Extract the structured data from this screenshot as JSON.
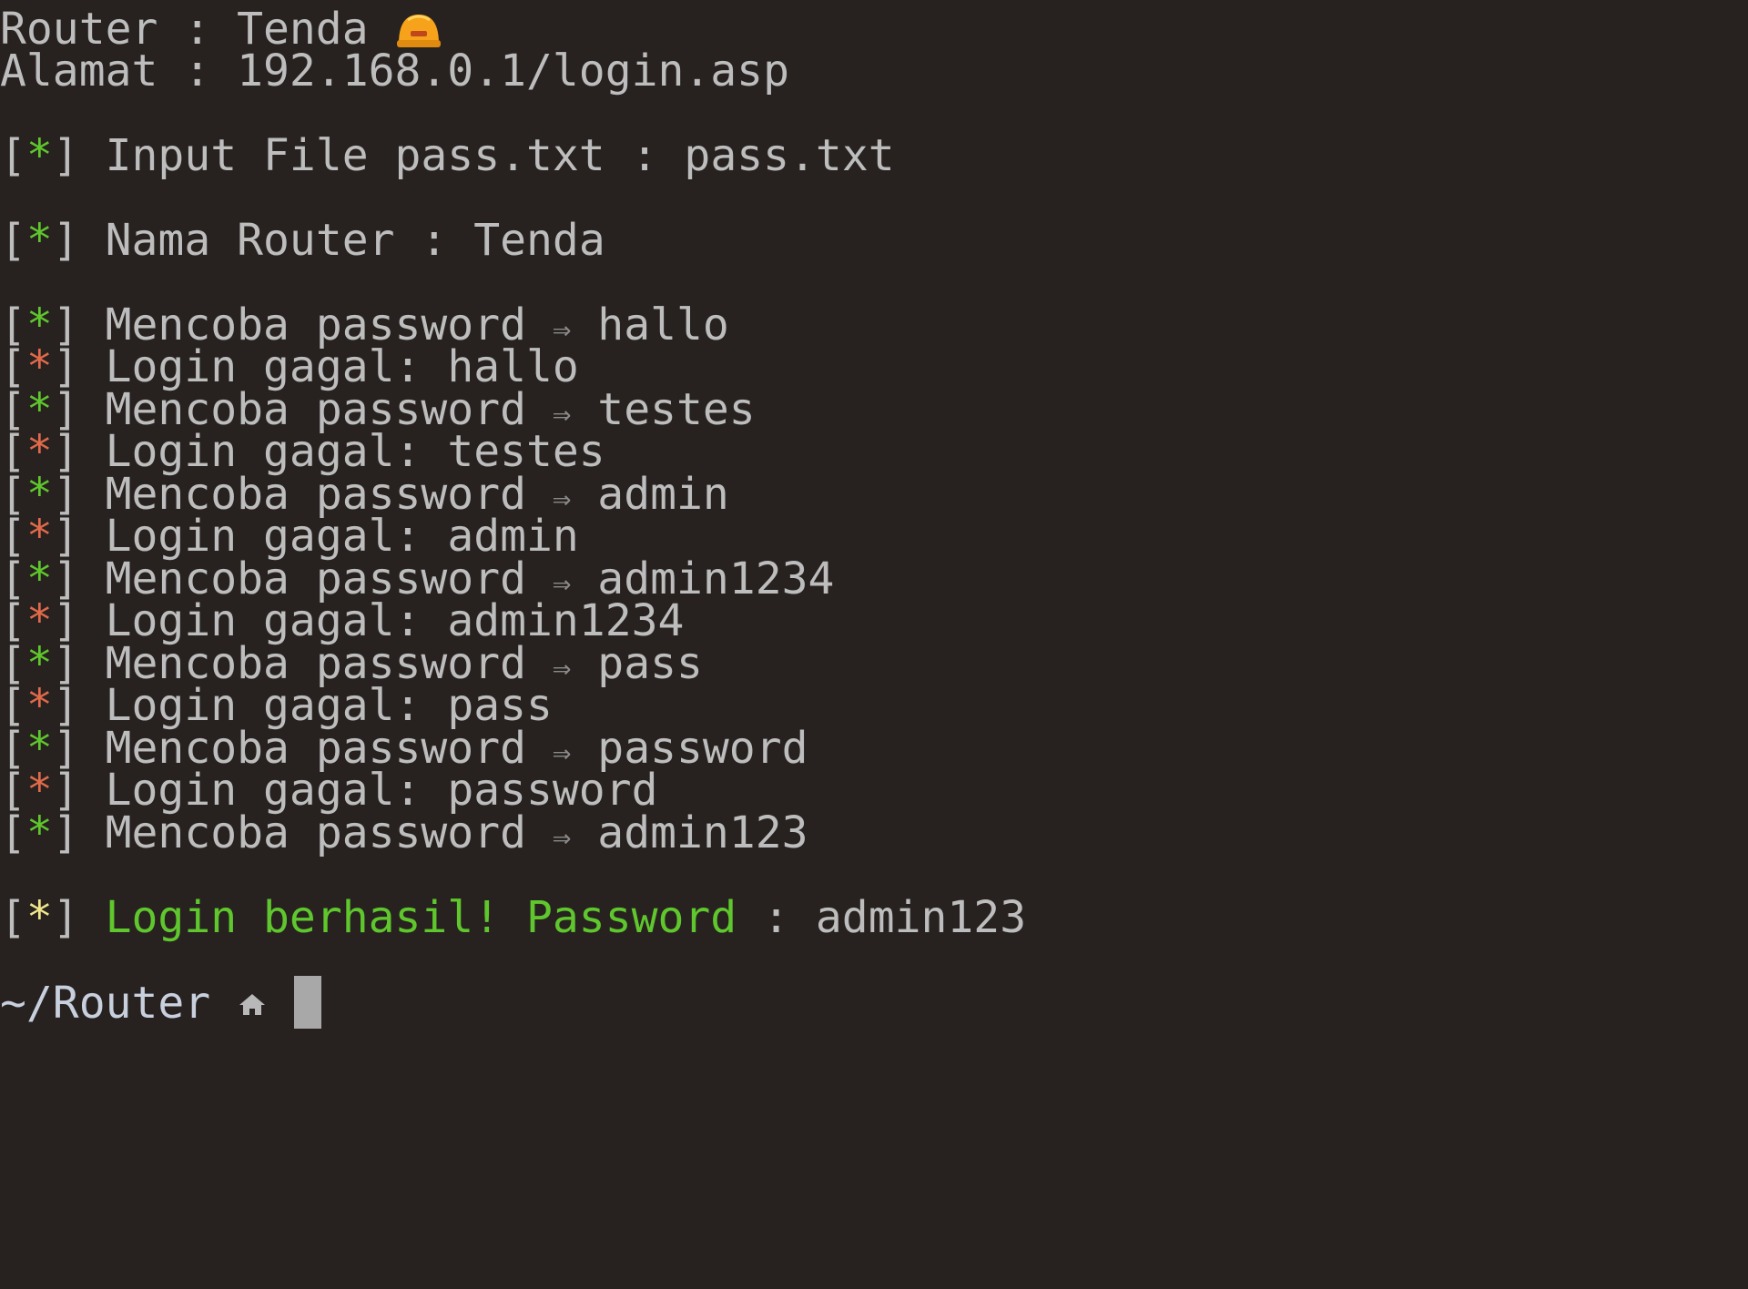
{
  "header": {
    "router_label": "Router",
    "router_value": "Tenda",
    "address_label": "Alamat",
    "address_value": "192.168.0.1/login.asp",
    "separator": ":"
  },
  "prefixes": {
    "open": "[",
    "star": "*",
    "close": "]"
  },
  "input_line": {
    "text": "Input File pass.txt",
    "separator": ":",
    "value": "pass.txt"
  },
  "name_line": {
    "text": "Nama Router",
    "separator": ":",
    "value": "Tenda"
  },
  "arrow": "⇒",
  "attempts": [
    {
      "try_label": "Mencoba password",
      "password": "hallo",
      "fail_label": "Login gagal:"
    },
    {
      "try_label": "Mencoba password",
      "password": "testes",
      "fail_label": "Login gagal:"
    },
    {
      "try_label": "Mencoba password",
      "password": "admin",
      "fail_label": "Login gagal:"
    },
    {
      "try_label": "Mencoba password",
      "password": "admin1234",
      "fail_label": "Login gagal:"
    },
    {
      "try_label": "Mencoba password",
      "password": "pass",
      "fail_label": "Login gagal:"
    },
    {
      "try_label": "Mencoba password",
      "password": "password",
      "fail_label": "Login gagal:"
    }
  ],
  "last_attempt": {
    "try_label": "Mencoba password",
    "password": "admin123"
  },
  "success": {
    "text": "Login berhasil! Password",
    "separator": ":",
    "value": "admin123"
  },
  "prompt": {
    "path": "~/Router",
    "icon": "house-icon"
  },
  "icons": {
    "router_icon": "helmet-icon"
  },
  "colors": {
    "background": "#272220",
    "text": "#bdbdbd",
    "green": "#5fc72d",
    "red": "#e06a4a",
    "yellow": "#f0e68c"
  }
}
